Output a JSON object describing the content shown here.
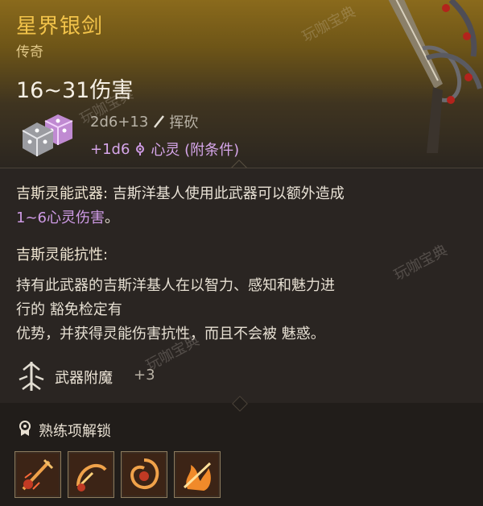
{
  "item": {
    "name": "星界银剑",
    "rarity": "传奇",
    "damage": "16~31伤害",
    "dice_base": "2d6+13",
    "damage_type": "挥砍",
    "dice_extra": "+1d6",
    "extra_type": "心灵 (附条件)"
  },
  "ability1": {
    "title": "吉斯灵能武器:",
    "text": " 吉斯洋基人使用此武器可以额外造成",
    "highlight": "1~6心灵伤害",
    "tail": "。"
  },
  "ability2": {
    "title": "吉斯灵能抗性:",
    "line1": "持有此武器的吉斯洋基人在以智力、感知和魅力进",
    "line2": "行的 豁免检定有",
    "line3": "优势，并获得灵能伤害抗性，而且不会被 魅惑。"
  },
  "enchant": {
    "label": "武器附魔",
    "bonus": "+3"
  },
  "proficiency": {
    "label": "熟练项解锁",
    "icons": [
      "slash-strike-icon",
      "whirl-slash-icon",
      "spin-attack-icon",
      "flame-strike-icon"
    ]
  },
  "watermark": "玩咖宝典",
  "colors": {
    "title": "#f2c34a",
    "psychic": "#cf9be6",
    "header": "#8a6a1c"
  }
}
